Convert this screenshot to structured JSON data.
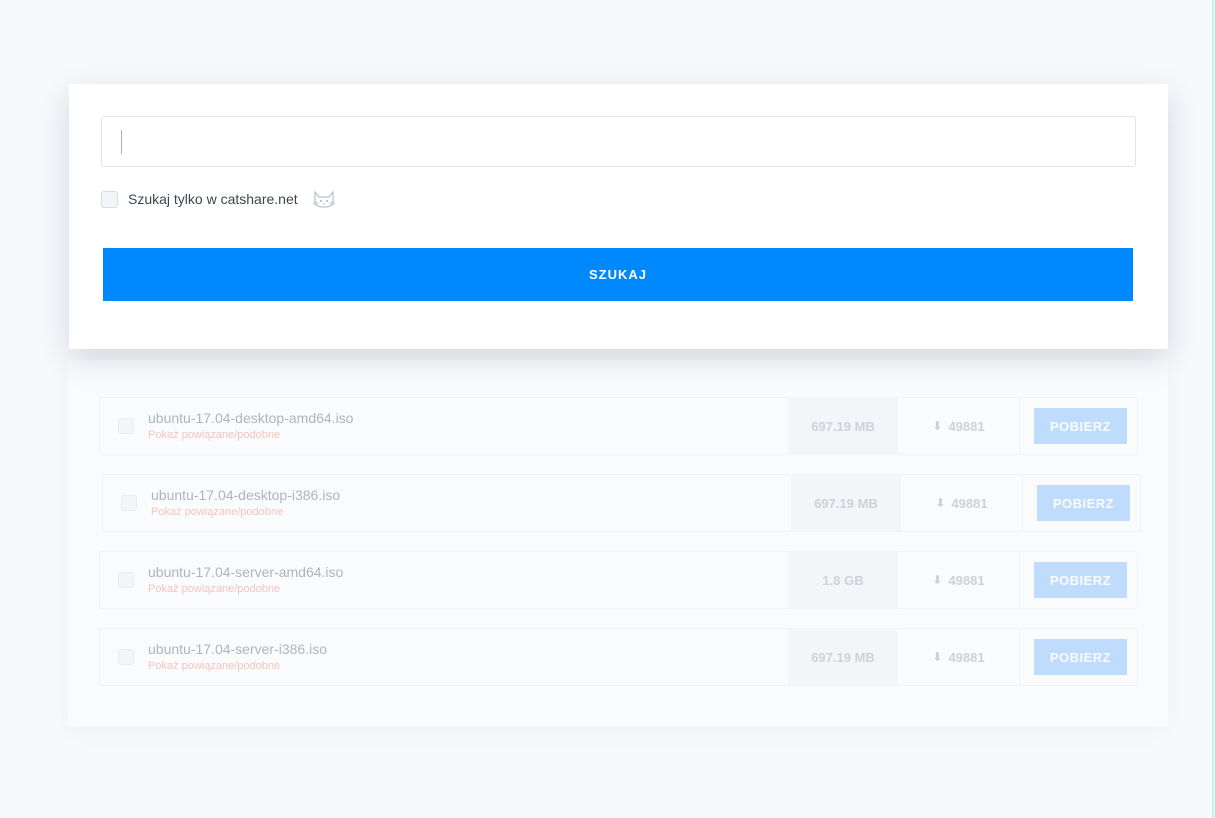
{
  "search": {
    "input_value": "",
    "input_placeholder": "",
    "filter_label": "Szukaj tylko w catshare.net",
    "filter_checked": false,
    "button_label": "SZUKAJ"
  },
  "results": [
    {
      "name": "ubuntu-17.04-desktop-amd64.iso",
      "related": "Pokaż powiązane/podobne",
      "size": "697.19 MB",
      "downloads": "49881",
      "button": "POBIERZ"
    },
    {
      "name": "ubuntu-17.04-desktop-i386.iso",
      "related": "Pokaż powiązane/podobne",
      "size": "697.19 MB",
      "downloads": "49881",
      "button": "POBIERZ"
    },
    {
      "name": "ubuntu-17.04-server-amd64.iso",
      "related": "Pokaż powiązane/podobne",
      "size": "1.8 GB",
      "downloads": "49881",
      "button": "POBIERZ"
    },
    {
      "name": "ubuntu-17.04-server-i386.iso",
      "related": "Pokaż powiązane/podobne",
      "size": "697.19 MB",
      "downloads": "49881",
      "button": "POBIERZ"
    }
  ],
  "icons": {
    "filter": "cat-icon",
    "download": "download-icon"
  },
  "colors": {
    "accent": "#0088ff",
    "download_button": "#66aefc",
    "related_link": "#f06f5f",
    "background": "#f7f9fc"
  }
}
